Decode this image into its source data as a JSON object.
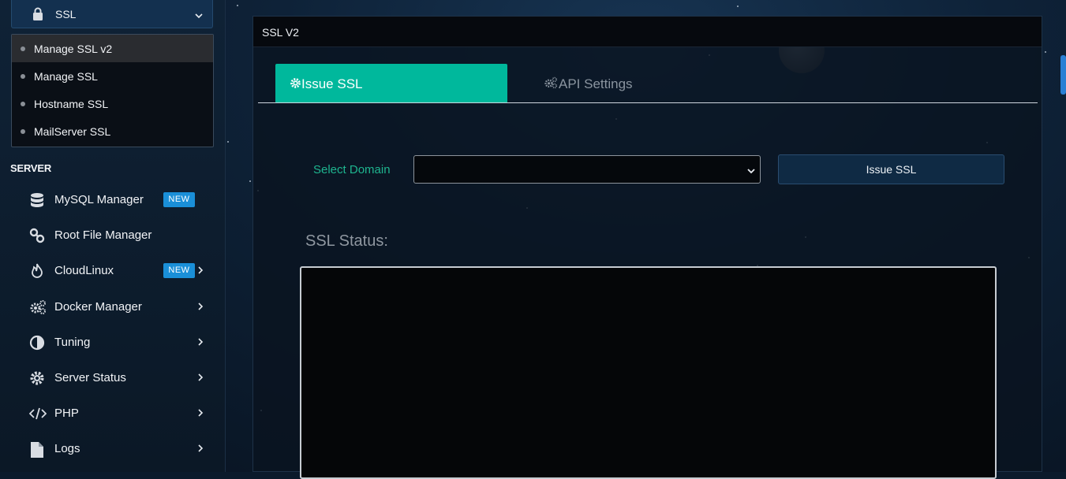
{
  "sidebar": {
    "ssl_label": "SSL",
    "ssl_items": [
      "Manage SSL v2",
      "Manage SSL",
      "Hostname SSL",
      "MailServer SSL"
    ],
    "section_title": "SERVER",
    "nav": [
      {
        "label": "MySQL Manager",
        "badge": "NEW",
        "icon": "database-icon"
      },
      {
        "label": "Root File Manager",
        "icon": "link-icon"
      },
      {
        "label": "CloudLinux",
        "badge": "NEW",
        "icon": "flame-icon"
      },
      {
        "label": "Docker Manager",
        "icon": "gears-icon"
      },
      {
        "label": "Tuning",
        "icon": "half-circle-icon"
      },
      {
        "label": "Server Status",
        "icon": "gear-icon"
      },
      {
        "label": "PHP",
        "icon": "code-icon"
      },
      {
        "label": "Logs",
        "icon": "file-icon"
      }
    ]
  },
  "panel": {
    "title": "SSL V2",
    "tabs": {
      "issue": "Issue SSL",
      "api": "API Settings"
    },
    "select_label": "Select Domain",
    "select_value": "",
    "issue_button": "Issue SSL",
    "status_label": "SSL Status:"
  },
  "colors": {
    "accent": "#00b89c",
    "badge": "#1a8fd8",
    "label_green": "#1eb58f"
  }
}
